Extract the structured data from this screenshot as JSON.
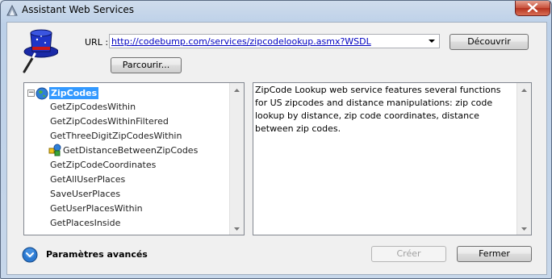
{
  "window": {
    "title": "Assistant Web Services"
  },
  "url": {
    "label": "URL :",
    "value": "http://codebump.com/services/zipcodelookup.asmx?WSDL"
  },
  "buttons": {
    "discover": "Découvrir",
    "browse": "Parcourir...",
    "create": "Créer",
    "close": "Fermer"
  },
  "tree": {
    "root": {
      "label": "ZipCodes",
      "icon": "globe-icon",
      "expander": "−"
    },
    "items": [
      {
        "label": "GetZipCodesWithin"
      },
      {
        "label": "GetZipCodesWithinFiltered"
      },
      {
        "label": "GetThreeDigitZipCodesWithin"
      },
      {
        "label": "GetDistanceBetweenZipCodes",
        "icon": "method-icon"
      },
      {
        "label": "GetZipCodeCoordinates"
      },
      {
        "label": "GetAllUserPlaces"
      },
      {
        "label": "SaveUserPlaces"
      },
      {
        "label": "GetUserPlacesWithin"
      },
      {
        "label": "GetPlacesInside"
      }
    ]
  },
  "description": "ZipCode Lookup web service features several functions for US zipcodes and distance manipulations: zip code lookup by distance, zip code coordinates, distance between zip codes.",
  "advanced": {
    "label": "Paramètres avancés"
  },
  "colors": {
    "selection": "#3399ff",
    "link": "#0000c0",
    "close_button": "#c8503a"
  }
}
